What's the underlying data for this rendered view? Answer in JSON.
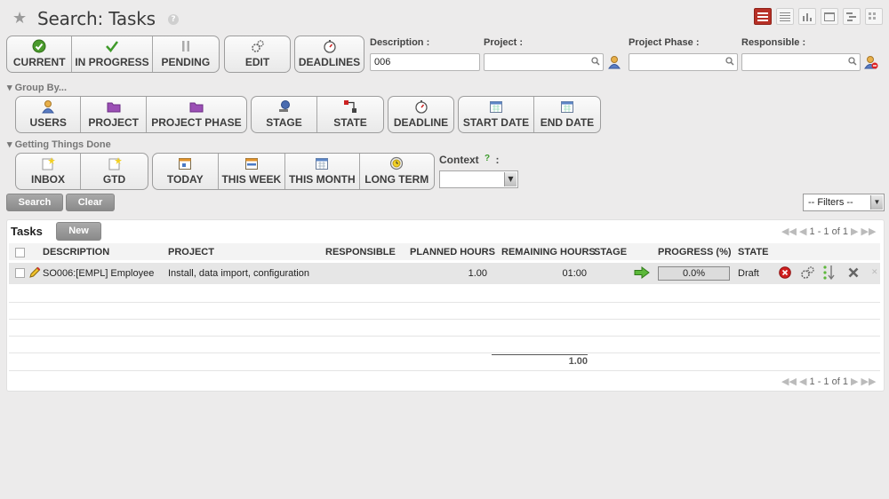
{
  "page": {
    "title": "Search: Tasks"
  },
  "header": {
    "help": "?"
  },
  "view_modes": [
    "list",
    "form",
    "graph",
    "calendar",
    "gantt",
    "kanban"
  ],
  "filters_main": [
    {
      "label": "CURRENT",
      "icon": "check-circle-icon"
    },
    {
      "label": "IN PROGRESS",
      "icon": "checkmark-icon"
    },
    {
      "label": "PENDING",
      "icon": "pause-icon"
    }
  ],
  "filter_edit": {
    "label": "EDIT",
    "icon": "gears-icon"
  },
  "filter_deadlines": {
    "label": "DEADLINES",
    "icon": "stopwatch-icon"
  },
  "fields": {
    "description": {
      "label": "Description :",
      "value": "006"
    },
    "project": {
      "label": "Project :",
      "value": ""
    },
    "project_phase": {
      "label": "Project Phase :",
      "value": ""
    },
    "responsible": {
      "label": "Responsible :",
      "value": ""
    }
  },
  "group_by": {
    "label": "Group By...",
    "buttons": [
      "USERS",
      "PROJECT",
      "PROJECT PHASE",
      "STAGE",
      "STATE",
      "DEADLINE",
      "START DATE",
      "END DATE"
    ]
  },
  "gtd": {
    "label": "Getting Things Done",
    "buttons": [
      "INBOX",
      "GTD",
      "TODAY",
      "THIS WEEK",
      "THIS MONTH",
      "LONG TERM"
    ]
  },
  "context": {
    "label": "Context",
    "help": "?",
    "colon": ":",
    "value": ""
  },
  "actions": {
    "search": "Search",
    "clear": "Clear",
    "filters": "-- Filters --"
  },
  "list": {
    "title": "Tasks",
    "new": "New",
    "pager": "1 - 1 of 1",
    "columns": [
      "DESCRIPTION",
      "PROJECT",
      "RESPONSIBLE",
      "PLANNED HOURS",
      "REMAINING HOURS",
      "STAGE",
      "PROGRESS (%)",
      "STATE"
    ],
    "rows": [
      {
        "description": "SO006:[EMPL] Employee",
        "project": "Install, data import, configuration",
        "responsible": "",
        "planned_hours": "1.00",
        "remaining_hours": "01:00",
        "stage": "",
        "progress_text": "0.0%",
        "progress": 0,
        "state": "Draft"
      }
    ],
    "total_planned": "1.00"
  },
  "colors": {
    "accent": "#b73026",
    "panel": "#ffffff",
    "background": "#ecebeb"
  }
}
